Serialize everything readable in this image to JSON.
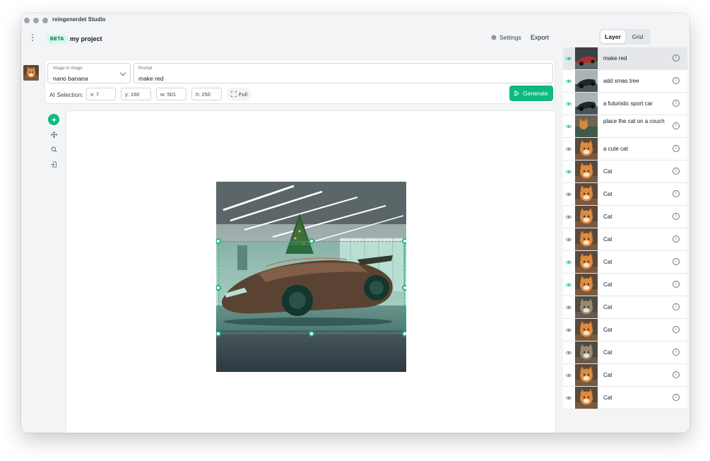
{
  "window": {
    "title": "reingenerdet Studio"
  },
  "header": {
    "badge": "BETA",
    "project_name": "my project",
    "settings_label": "Settings",
    "export_label": "Export"
  },
  "toolbar": {
    "mode_label": "Image to Image",
    "model_value": "nano banana",
    "prompt_label": "Prompt",
    "prompt_value": "make red",
    "selection_label": "AI Selection:",
    "x": "x: 7",
    "y": "y: 160",
    "w": "w: 501",
    "h": "h: 250",
    "full_label": "Full",
    "generate_label": "Generate"
  },
  "sidepanel": {
    "tabs": [
      {
        "label": "Layer"
      },
      {
        "label": "Grid"
      }
    ],
    "layers": [
      {
        "name": "make red",
        "thumb": "red-car"
      },
      {
        "name": "add xmas tree",
        "thumb": "dark-car"
      },
      {
        "name": "a futuristic sport car",
        "thumb": "dark-car"
      },
      {
        "name": "place the cat on a couch",
        "thumb": "cat-couch"
      },
      {
        "name": "a cute cat",
        "thumb": "cat"
      },
      {
        "name": "Cat",
        "thumb": "cat"
      },
      {
        "name": "Cat",
        "thumb": "cat"
      },
      {
        "name": "Cat",
        "thumb": "cat"
      },
      {
        "name": "Cat",
        "thumb": "cat"
      },
      {
        "name": "Cat",
        "thumb": "cat"
      },
      {
        "name": "Cat",
        "thumb": "cat"
      },
      {
        "name": "Cat",
        "thumb": "tabby"
      },
      {
        "name": "Cat",
        "thumb": "cat"
      },
      {
        "name": "Cat",
        "thumb": "tabby"
      },
      {
        "name": "Cat",
        "thumb": "cat"
      },
      {
        "name": "Cat",
        "thumb": "cat"
      }
    ]
  },
  "colors": {
    "accent": "#10b981",
    "badge_bg": "#d1fae5"
  }
}
